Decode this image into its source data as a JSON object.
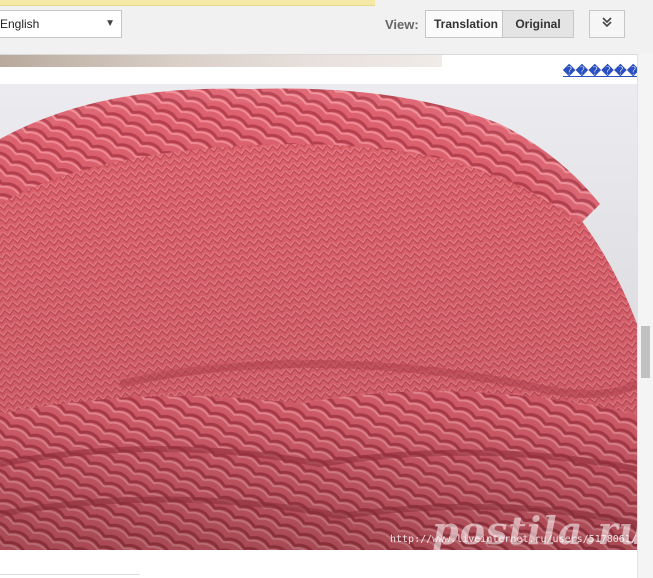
{
  "translate_bar": {
    "language": "English",
    "view_label": "View:",
    "options": [
      "Translation",
      "Original"
    ],
    "selected": "Original",
    "expand_icon": "double-chevron-down-icon"
  },
  "sidebar": {
    "link_text": "������"
  },
  "photo": {
    "watermark_url": "http://www.liveinternet.ru/users/5178061/",
    "logo_text": "postila.ru"
  },
  "colors": {
    "knit_base": "#e06470",
    "knit_dark": "#b8404e",
    "knit_light": "#f08a92",
    "link": "#2a4fbf"
  }
}
